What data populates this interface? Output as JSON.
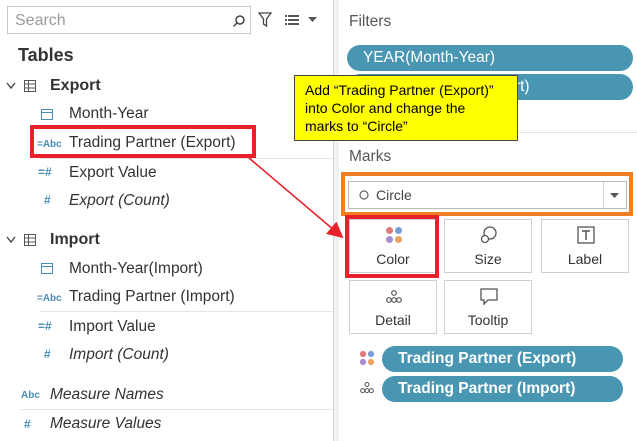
{
  "search": {
    "placeholder": "Search"
  },
  "tables_heading": "Tables",
  "export_group": {
    "label": "Export",
    "fields": [
      {
        "label": "Month-Year",
        "icon": "calendar-icon"
      },
      {
        "label": "Trading Partner (Export)",
        "icon": "abc-icon",
        "icon_text": "=Abc"
      },
      {
        "label": "Export Value",
        "icon": "measure-icon"
      },
      {
        "label": "Export (Count)",
        "icon": "measure-icon"
      }
    ]
  },
  "import_group": {
    "label": "Import",
    "fields": [
      {
        "label": "Month-Year(Import)",
        "icon": "calendar-icon"
      },
      {
        "label": "Trading Partner (Import)",
        "icon": "abc-icon",
        "icon_text": "=Abc"
      },
      {
        "label": "Import Value",
        "icon": "measure-icon"
      },
      {
        "label": "Import (Count)",
        "icon": "measure-icon"
      }
    ]
  },
  "measure_names": {
    "label": "Measure Names",
    "icon_text": "Abc"
  },
  "measure_values": {
    "label": "Measure Values"
  },
  "filters": {
    "title": "Filters",
    "pills": [
      "YEAR(Month-Year)",
      "Trading Partner (Export)"
    ]
  },
  "marks": {
    "title": "Marks",
    "mark_type": "Circle",
    "cards": [
      "Color",
      "Size",
      "Label",
      "Detail",
      "Tooltip"
    ],
    "pills": [
      "Trading Partner (Export)",
      "Trading Partner (Import)"
    ]
  },
  "callout": {
    "text": "Add “Trading Partner (Export)” into Color and change the marks to “Circle”"
  },
  "colors": {
    "pill": "#4996b2",
    "highlight_red": "#e8202a",
    "highlight_orange": "#f07f24",
    "callout_bg": "#ffff00"
  }
}
